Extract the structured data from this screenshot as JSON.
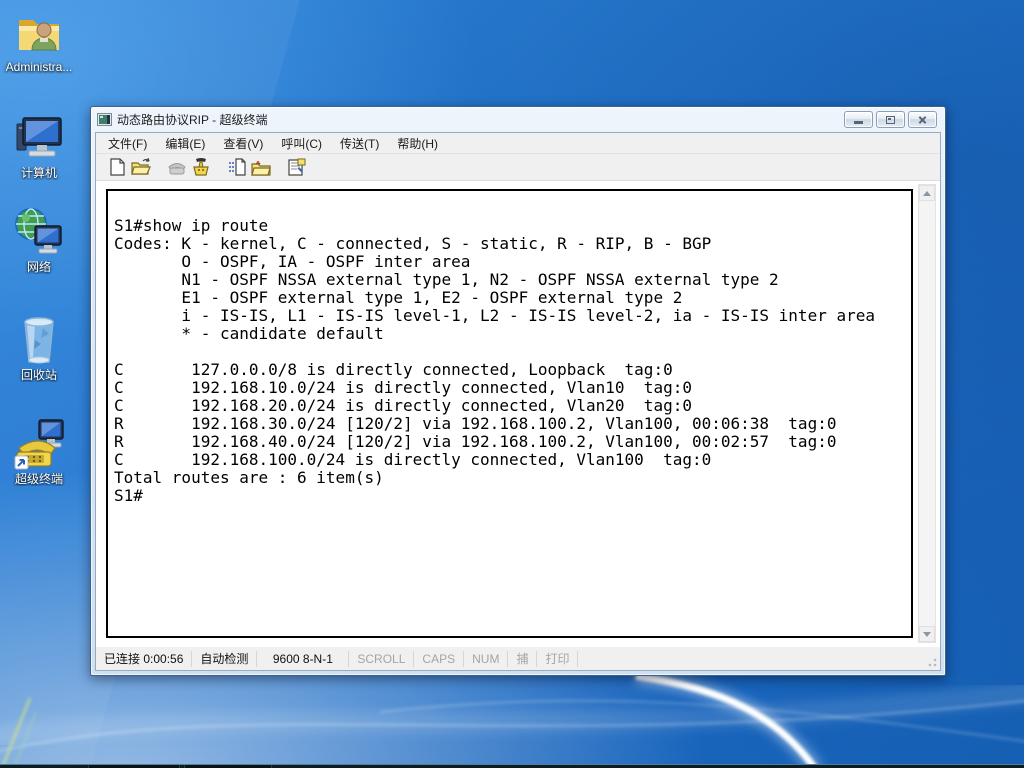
{
  "colors": {
    "wallpaper_blue": "#2278d2",
    "terminal_bg": "#ffffff",
    "terminal_fg": "#000000",
    "status_disabled_text": "#a5a5a5",
    "frame_blue": "#d9e6f4"
  },
  "desktop": {
    "icons": [
      {
        "name": "administrator-folder-icon",
        "label": "Administra..."
      },
      {
        "name": "computer-icon",
        "label": "计算机"
      },
      {
        "name": "network-icon",
        "label": "网络"
      },
      {
        "name": "recycle-bin-icon",
        "label": "回收站"
      },
      {
        "name": "hyperterminal-icon",
        "label": "超级终端"
      }
    ]
  },
  "window": {
    "title": "动态路由协议RIP - 超级终端",
    "caption": {
      "buttons": [
        "minimize-icon",
        "maximize-icon",
        "close-icon"
      ]
    },
    "menu": {
      "items": [
        {
          "label": "文件(F)"
        },
        {
          "label": "编辑(E)"
        },
        {
          "label": "查看(V)"
        },
        {
          "label": "呼叫(C)"
        },
        {
          "label": "传送(T)"
        },
        {
          "label": "帮助(H)"
        }
      ]
    },
    "toolbar": {
      "icons": [
        "new-connection-icon",
        "open-icon",
        "call-icon",
        "disconnect-icon",
        "send-file-icon",
        "receive-file-icon",
        "properties-icon"
      ]
    },
    "terminal": {
      "lines": [
        "S1#show ip route",
        "Codes: K - kernel, C - connected, S - static, R - RIP, B - BGP",
        "       O - OSPF, IA - OSPF inter area",
        "       N1 - OSPF NSSA external type 1, N2 - OSPF NSSA external type 2",
        "       E1 - OSPF external type 1, E2 - OSPF external type 2",
        "       i - IS-IS, L1 - IS-IS level-1, L2 - IS-IS level-2, ia - IS-IS inter area",
        "       * - candidate default",
        "",
        "C       127.0.0.0/8 is directly connected, Loopback  tag:0",
        "C       192.168.10.0/24 is directly connected, Vlan10  tag:0",
        "C       192.168.20.0/24 is directly connected, Vlan20  tag:0",
        "R       192.168.30.0/24 [120/2] via 192.168.100.2, Vlan100, 00:06:38  tag:0",
        "R       192.168.40.0/24 [120/2] via 192.168.100.2, Vlan100, 00:02:57  tag:0",
        "C       192.168.100.0/24 is directly connected, Vlan100  tag:0",
        "Total routes are : 6 item(s)",
        "S1#"
      ]
    },
    "statusbar": {
      "connection": "已连接 0:00:56",
      "detect": "自动检测",
      "baud": "9600 8-N-1",
      "indicators": [
        {
          "label": "SCROLL"
        },
        {
          "label": "CAPS"
        },
        {
          "label": "NUM"
        },
        {
          "label": "捕"
        },
        {
          "label": "打印"
        }
      ]
    }
  }
}
